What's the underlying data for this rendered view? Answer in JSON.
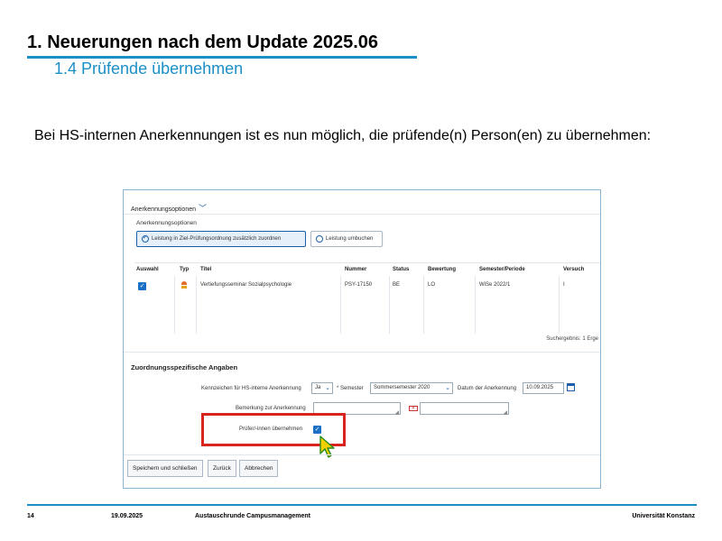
{
  "slide": {
    "title": "1. Neuerungen nach dem Update 2025.06",
    "subtitle": "1.4 Prüfende übernehmen",
    "body": "Bei HS-internen Anerkennungen ist es nun möglich, die prüfende(n) Person(en) zu übernehmen:"
  },
  "screenshot": {
    "options_header": "Anerkennungsoptionen",
    "options_label": "Anerkennungsoptionen",
    "option_buttons": [
      "Leistung in Ziel-Prüfungsordnung zusätzlich zuordnen",
      "Leistung umbuchen"
    ],
    "table": {
      "headers": [
        "Auswahl",
        "Typ",
        "Titel",
        "Nummer",
        "Status",
        "Bewertung",
        "Semester/Periode",
        "Versuch"
      ],
      "row": {
        "title": "Vertiefungsseminar Sozialpsychologie",
        "number": "PSY-17150",
        "status": "BE",
        "grade": "LO",
        "semester": "WiSe 2022/1",
        "attempt": "I"
      },
      "results": "Suchergebnis: 1 Erge"
    },
    "section_title": "Zuordnungsspezifische Angaben",
    "fields": {
      "kennzeichen_label": "Kennzeichen für HS-interne Anerkennung",
      "kennzeichen_value": "Ja",
      "semester_label": "* Semester",
      "semester_value": "Sommersemester 2020",
      "date_label": "Datum der Anerkennung",
      "date_value": "10.09.2025",
      "bemerkung_label": "Bemerkung zur Anerkennung",
      "pruefer_label": "Prüfer/-innen übernehmen"
    },
    "buttons": [
      "Speichern und schließen",
      "Zurück",
      "Abbrechen"
    ]
  },
  "footer": {
    "page": "14",
    "date": "19.09.2025",
    "event": "Austauschrunde Campusmanagement",
    "org": "Universität Konstanz"
  }
}
